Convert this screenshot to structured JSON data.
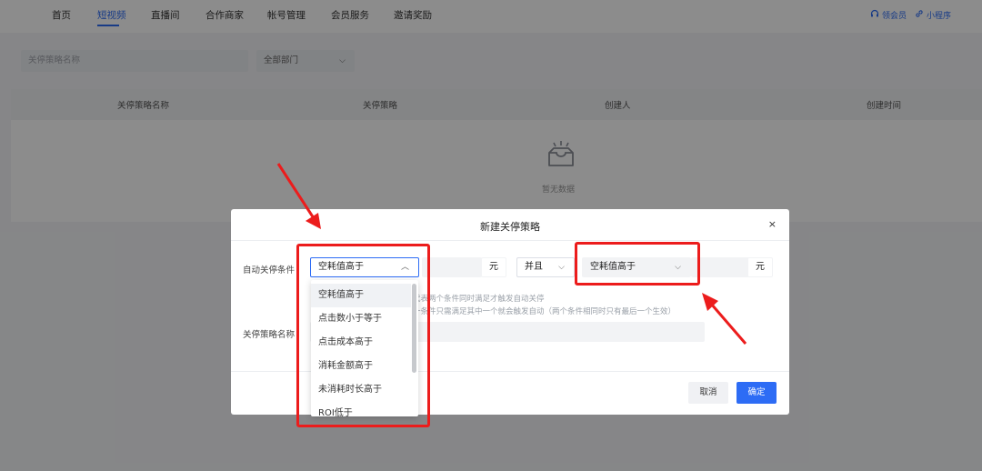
{
  "nav": {
    "items": [
      "首页",
      "短视频",
      "直播间",
      "合作商家",
      "帐号管理",
      "会员服务",
      "邀请奖励"
    ],
    "active_index": 1,
    "right_links": [
      "领会员",
      "小程序"
    ]
  },
  "filters": {
    "name_placeholder": "关停策略名称",
    "department_value": "全部部门"
  },
  "table": {
    "columns": [
      "关停策略名称",
      "关停策略",
      "创建人",
      "创建时间"
    ],
    "empty_text": "暂无数据"
  },
  "modal": {
    "title": "新建关停策略",
    "close_label": "×",
    "auto_stop_label": "自动关停条件",
    "condition1_value": "空耗值高于",
    "unit1": "元",
    "logic_value": "并且",
    "condition2_value": "空耗值高于",
    "unit2": "元",
    "hint_line1": "代表两个条件同时满足才触发自动关停",
    "hint_line2": "一条件只需满足其中一个就会触发自动（两个条件相同时只有最后一个生效）",
    "name_label": "关停策略名称",
    "cancel_label": "取消",
    "ok_label": "确定"
  },
  "dropdown": {
    "options": [
      "空耗值高于",
      "点击数小于等于",
      "点击成本高于",
      "消耗金额高于",
      "未消耗时长高于",
      "ROI低于"
    ],
    "selected_index": 0
  },
  "colors": {
    "accent": "#2d6cf5",
    "annotation": "#ec1c1c"
  }
}
